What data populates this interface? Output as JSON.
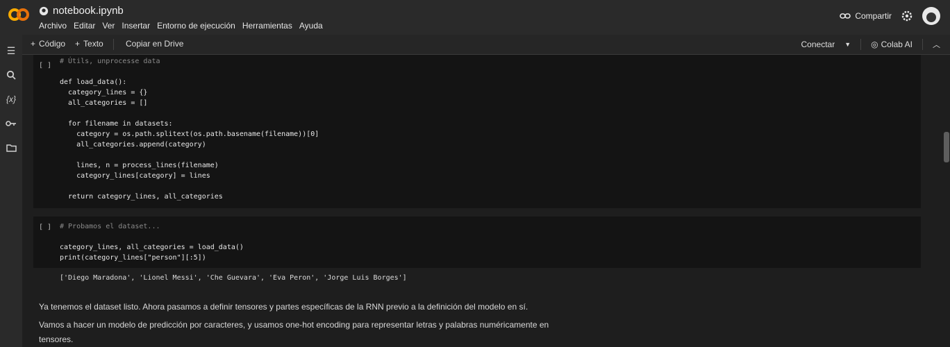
{
  "app": {
    "title": "notebook.ipynb"
  },
  "menu": [
    "Archivo",
    "Editar",
    "Ver",
    "Insertar",
    "Entorno de ejecución",
    "Herramientas",
    "Ayuda"
  ],
  "header": {
    "share_label": "Compartir"
  },
  "icons": {
    "logo": "colab-logo",
    "github": "github-icon",
    "share": "link-icon",
    "settings": "gear-icon",
    "sidebar": [
      "list-icon",
      "search-icon",
      "variables-icon",
      "key-icon",
      "folder-icon"
    ]
  },
  "toolbar": {
    "code_label": "Código",
    "text_label": "Texto",
    "copy_label": "Copiar en Drive",
    "connect_label": "Conectar",
    "colab_ai_label": "Colab AI"
  },
  "cells": {
    "cell1": {
      "bracket": "[ ]",
      "lines": [
        "# Útils, unprocesse data",
        "",
        "def load_data():",
        "  category_lines = {}",
        "  all_categories = []",
        "",
        "  for filename in datasets:",
        "    category = os.path.splitext(os.path.basename(filename))[0]",
        "    all_categories.append(category)",
        "",
        "    lines, n = process_lines(filename)",
        "    category_lines[category] = lines",
        "",
        "  return category_lines, all_categories"
      ]
    },
    "cell2": {
      "bracket": "[ ]",
      "comment": "# Probamos el dataset...",
      "lines": [
        "category_lines, all_categories = load_data()",
        "print(category_lines[\"person\"][:5])"
      ],
      "output": "['Diego Maradona', 'Lionel Messi', 'Che Guevara', 'Eva Peron', 'Jorge Luis Borges']"
    }
  },
  "text_cell": {
    "p1": "Ya tenemos el dataset listo. Ahora pasamos a definir tensores y partes específicas de la RNN previo a la definición del modelo en sí.",
    "p2": "Vamos a hacer un modelo de predicción por caracteres, y usamos one-hot encoding para representar letras y palabras numéricamente en",
    "p3": "tensores."
  }
}
